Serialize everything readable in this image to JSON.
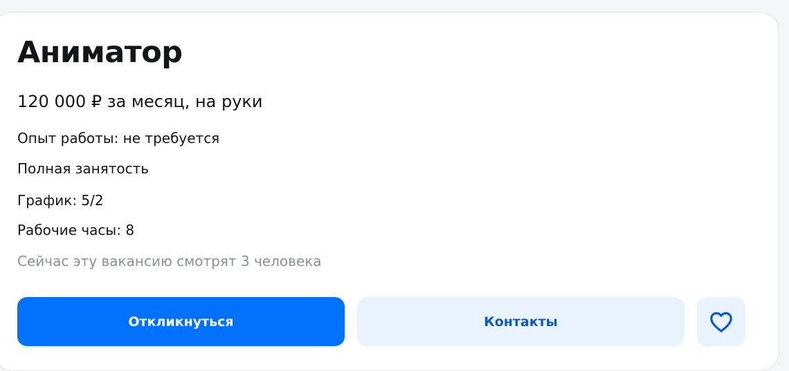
{
  "vacancy": {
    "title": "Аниматор",
    "salary": "120 000 ₽ за месяц, на руки",
    "details": {
      "experience": "Опыт работы: не требуется",
      "employment": "Полная занятость",
      "schedule": "График: 5/2",
      "hours": "Рабочие часы: 8"
    },
    "viewers": "Сейчас эту вакансию смотрят 3 человека"
  },
  "actions": {
    "respond_label": "Откликнуться",
    "contacts_label": "Контакты",
    "favorite_icon": "heart-icon"
  },
  "colors": {
    "primary": "#0070ff",
    "secondary_bg": "#e9f3fd",
    "secondary_text": "#0a58ca",
    "muted_text": "#8a9096"
  }
}
